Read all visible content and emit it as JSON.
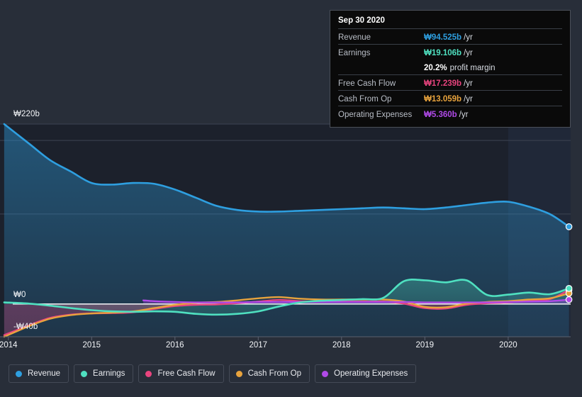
{
  "axes": {
    "y_labels": [
      {
        "text": "₩220b",
        "value": 220
      },
      {
        "text": "₩0",
        "value": 0
      },
      {
        "text": "-₩40b",
        "value": -40
      }
    ],
    "x_labels": [
      "2014",
      "2015",
      "2016",
      "2017",
      "2018",
      "2019",
      "2020"
    ]
  },
  "tooltip": {
    "date": "Sep 30 2020",
    "rows": [
      {
        "label": "Revenue",
        "value": "₩94.525b",
        "unit": "/yr",
        "color": "#2e9fe0"
      },
      {
        "label": "Earnings",
        "value": "₩19.106b",
        "unit": "/yr",
        "color": "#4fe0c0"
      },
      {
        "label": "",
        "value": "20.2%",
        "unit": "profit margin",
        "color": "#ffffff",
        "margin": true
      },
      {
        "label": "Free Cash Flow",
        "value": "₩17.239b",
        "unit": "/yr",
        "color": "#e8447e"
      },
      {
        "label": "Cash From Op",
        "value": "₩13.059b",
        "unit": "/yr",
        "color": "#e8a33d"
      },
      {
        "label": "Operating Expenses",
        "value": "₩5.360b",
        "unit": "/yr",
        "color": "#b04ae8"
      }
    ]
  },
  "legend": {
    "items": [
      {
        "label": "Revenue",
        "color": "#2e9fe0"
      },
      {
        "label": "Earnings",
        "color": "#4fe0c0"
      },
      {
        "label": "Free Cash Flow",
        "color": "#e8447e"
      },
      {
        "label": "Cash From Op",
        "color": "#e8a33d"
      },
      {
        "label": "Operating Expenses",
        "color": "#b04ae8"
      }
    ]
  },
  "chart_data": {
    "type": "area",
    "title": "",
    "xlabel": "",
    "ylabel": "",
    "ylim": [
      -40,
      220
    ],
    "xlim": [
      2013.9,
      2020.75
    ],
    "grid": true,
    "legend_position": "bottom",
    "currency": "KRW (₩)",
    "unit": "billions per year",
    "gridlines_y": [
      220,
      200,
      110,
      0,
      -40
    ],
    "zero_line": 0,
    "highlight_band_start": 2020.0,
    "series": [
      {
        "name": "Revenue",
        "color": "#2e9fe0",
        "filled": true,
        "x": [
          2013.95,
          2014.25,
          2014.5,
          2014.75,
          2015.0,
          2015.25,
          2015.5,
          2015.75,
          2016.0,
          2016.25,
          2016.5,
          2016.75,
          2017.0,
          2017.25,
          2017.5,
          2017.75,
          2018.0,
          2018.25,
          2018.5,
          2018.75,
          2019.0,
          2019.25,
          2019.5,
          2019.75,
          2020.0,
          2020.25,
          2020.5,
          2020.73
        ],
        "values": [
          220,
          196,
          176,
          162,
          148,
          146,
          148,
          147,
          140,
          130,
          120,
          115,
          113,
          113,
          114,
          115,
          116,
          117,
          118,
          117,
          116,
          118,
          121,
          124,
          125,
          119,
          110,
          94.525
        ]
      },
      {
        "name": "Earnings",
        "color": "#4fe0c0",
        "filled": true,
        "x": [
          2013.95,
          2014.25,
          2014.5,
          2014.75,
          2015.0,
          2015.25,
          2015.5,
          2015.75,
          2016.0,
          2016.25,
          2016.5,
          2016.75,
          2017.0,
          2017.25,
          2017.5,
          2017.75,
          2018.0,
          2018.25,
          2018.5,
          2018.75,
          2019.0,
          2019.25,
          2019.5,
          2019.75,
          2020.0,
          2020.25,
          2020.5,
          2020.73
        ],
        "values": [
          2.0,
          0.5,
          -2.0,
          -5.0,
          -7.5,
          -9.0,
          -9.5,
          -9.0,
          -9.5,
          -12.0,
          -13.0,
          -12.0,
          -9.0,
          -3.0,
          2.0,
          4.0,
          5.0,
          6.0,
          7.5,
          28.0,
          29.0,
          26.5,
          29.0,
          11.0,
          11.5,
          14.0,
          12.0,
          19.106
        ]
      },
      {
        "name": "Free Cash Flow",
        "color": "#e8447e",
        "filled": false,
        "x": [
          2013.95,
          2014.25,
          2014.5,
          2014.75,
          2015.0,
          2015.25,
          2015.5,
          2015.75,
          2016.0,
          2016.25,
          2016.5,
          2016.75,
          2017.0,
          2017.25,
          2017.5,
          2017.75,
          2018.0,
          2018.25,
          2018.5,
          2018.75,
          2019.0,
          2019.25,
          2019.5,
          2019.75,
          2020.0,
          2020.25,
          2020.5,
          2020.73
        ],
        "values": [
          -38.0,
          -26.0,
          -17.0,
          -13.0,
          -11.5,
          -11.0,
          -10.0,
          -6.0,
          -2.5,
          -1.0,
          -0.5,
          1.0,
          3.0,
          5.0,
          3.5,
          3.0,
          3.0,
          3.0,
          3.0,
          0.5,
          -5.0,
          -5.5,
          -1.0,
          1.0,
          2.0,
          4.0,
          6.0,
          17.239
        ]
      },
      {
        "name": "Cash From Op",
        "color": "#e8a33d",
        "filled": false,
        "x": [
          2013.95,
          2014.25,
          2014.5,
          2014.75,
          2015.0,
          2015.25,
          2015.5,
          2015.75,
          2016.0,
          2016.25,
          2016.5,
          2016.75,
          2017.0,
          2017.25,
          2017.5,
          2017.75,
          2018.0,
          2018.25,
          2018.5,
          2018.75,
          2019.0,
          2019.25,
          2019.5,
          2019.75,
          2020.0,
          2020.25,
          2020.5,
          2020.73
        ],
        "values": [
          -40.0,
          -27.0,
          -18.0,
          -13.5,
          -11.5,
          -10.5,
          -9.0,
          -5.0,
          -1.0,
          1.5,
          2.5,
          4.5,
          7.0,
          8.5,
          6.5,
          5.5,
          5.5,
          5.5,
          5.5,
          3.0,
          -3.5,
          -4.0,
          0.5,
          2.5,
          3.5,
          5.5,
          7.0,
          13.059
        ]
      },
      {
        "name": "Operating Expenses",
        "color": "#b04ae8",
        "filled": false,
        "x": [
          2015.62,
          2015.75,
          2016.0,
          2016.25,
          2016.5,
          2016.75,
          2017.0,
          2017.25,
          2017.5,
          2017.75,
          2018.0,
          2018.25,
          2018.5,
          2018.75,
          2019.0,
          2019.25,
          2019.5,
          2019.75,
          2020.0,
          2020.25,
          2020.5,
          2020.73
        ],
        "values": [
          4.5,
          3.5,
          2.5,
          2.0,
          2.0,
          2.0,
          2.5,
          2.5,
          2.5,
          2.5,
          2.5,
          2.5,
          2.5,
          2.5,
          2.0,
          2.0,
          2.0,
          2.0,
          2.5,
          3.0,
          3.5,
          5.36
        ]
      }
    ]
  },
  "colors": {
    "background": "#282e39",
    "plot_background": "#1c212c",
    "tooltip_background": "#0a0a0a",
    "gridline": "#3c4352",
    "zero_line": "#e8eaee"
  }
}
